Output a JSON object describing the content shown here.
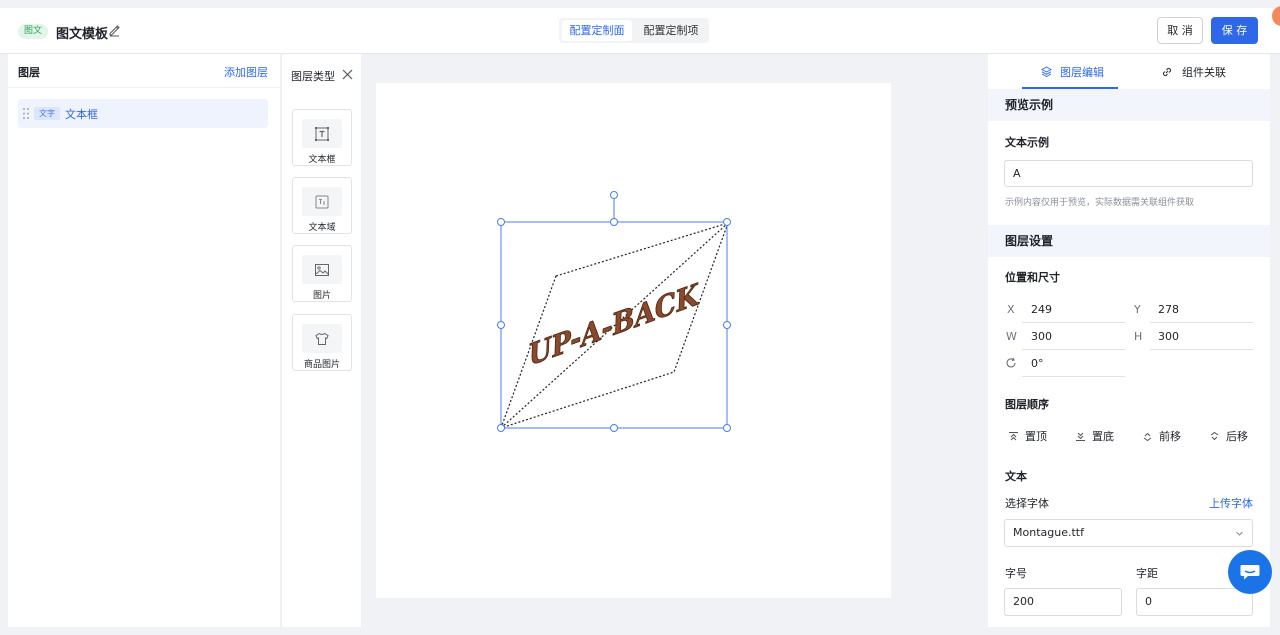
{
  "header": {
    "tag": "图文",
    "title": "图文模板",
    "tabs": [
      "配置定制面",
      "配置定制项"
    ],
    "cancel_label": "取 消",
    "save_label": "保 存"
  },
  "layers": {
    "title": "图层",
    "add_label": "添加图层",
    "items": [
      {
        "tag": "文字",
        "name": "文本框"
      }
    ]
  },
  "layer_types": {
    "title": "图层类型",
    "items": [
      "文本框",
      "文本域",
      "图片",
      "商品图片"
    ]
  },
  "canvas": {
    "sample_text": "UP-A-BACK",
    "text_color": "#8b4a2b"
  },
  "panel": {
    "tabs": [
      "图层编辑",
      "组件关联"
    ],
    "preview_section": "预览示例",
    "sample_label": "文本示例",
    "sample_value": "A",
    "sample_hint": "示例内容仅用于预览，实际数据需关联组件获取",
    "layer_section": "图层设置",
    "position_label": "位置和尺寸",
    "x_label": "X",
    "x_value": "249",
    "y_label": "Y",
    "y_value": "278",
    "w_label": "W",
    "w_value": "300",
    "h_label": "H",
    "h_value": "300",
    "rotation_value": "0°",
    "order_label": "图层顺序",
    "order_items": [
      "置顶",
      "置底",
      "前移",
      "后移"
    ],
    "text_section": "文本",
    "font_label": "选择字体",
    "upload_font_label": "上传字体",
    "font_value": "Montague.ttf",
    "size_label": "字号",
    "size_value": "200",
    "spacing_label": "字距",
    "spacing_value": "0"
  },
  "colors": {
    "accent": "#2e68e8"
  }
}
